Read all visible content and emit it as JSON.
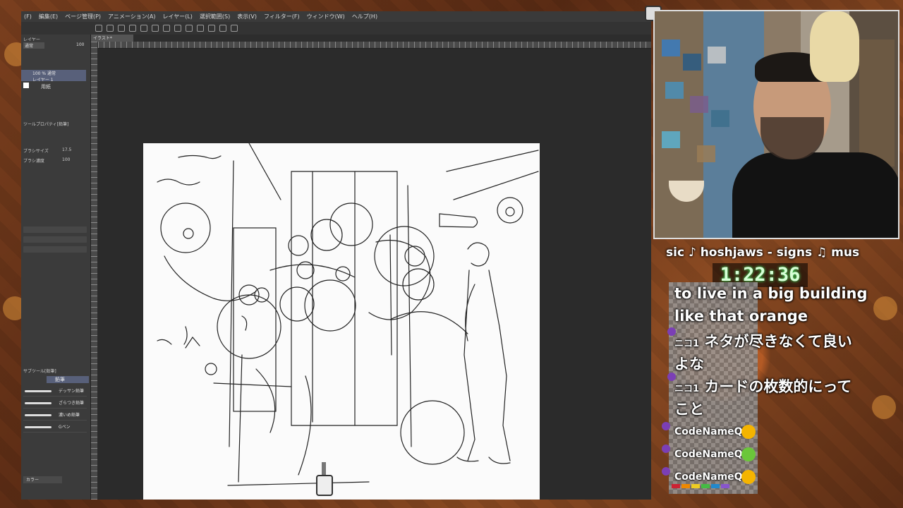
{
  "menu": [
    "(F)",
    "編集(E)",
    "ページ管理(P)",
    "アニメーション(A)",
    "レイヤー(L)",
    "選択範囲(S)",
    "表示(V)",
    "フィルター(F)",
    "ウィンドウ(W)",
    "ヘルプ(H)"
  ],
  "left_panel": {
    "layer_header": "レイヤー",
    "blend_mode": "通常",
    "opacity": "100",
    "layer_selected": "100 % 通常",
    "layer_selected_sub": "レイヤー 1",
    "paper_layer": "用紙",
    "tool_property_header": "ツールプロパティ[鉛筆]",
    "brush_size_label": "ブラシサイズ",
    "brush_size_value": "17.5",
    "density_label": "ブラシ濃度",
    "density_value": "100",
    "subtool_header": "サブツール[鉛筆]",
    "subtool_tab": "鉛筆",
    "subtool_items": [
      "デッサン鉛筆",
      "ざらつき鉛筆",
      "濃いめ鉛筆",
      "Gペン"
    ],
    "color_label": "カラー"
  },
  "document_tab": "イラスト*",
  "ticker_text": "sic ♪ hoshjaws - signs      ♫ mus",
  "timer": "1:22:36",
  "chat": {
    "lines": [
      {
        "text": "to live in a big building"
      },
      {
        "text": "like that orange"
      },
      {
        "prefix": "ニコ1",
        "text": "ネタが尽きなくて良い"
      },
      {
        "text": "よな"
      },
      {
        "prefix": "ニコ1",
        "text": "カードの枚数的にって"
      },
      {
        "text": "こと"
      }
    ],
    "users": [
      {
        "name": "CodeNameQR",
        "emoji": "grin-emoji",
        "color": "#f5b400"
      },
      {
        "name": "CodeNameQR",
        "emoji": "smile-emoji",
        "color": "#6bc63a"
      },
      {
        "name": "CodeNameQR",
        "emoji": "thumbs-up-emoji",
        "color": "#f5b400"
      }
    ]
  },
  "colors": {
    "accent_layer": "#58607a",
    "timer_glow": "#3fff6a",
    "badge": "#7b3fb5"
  }
}
